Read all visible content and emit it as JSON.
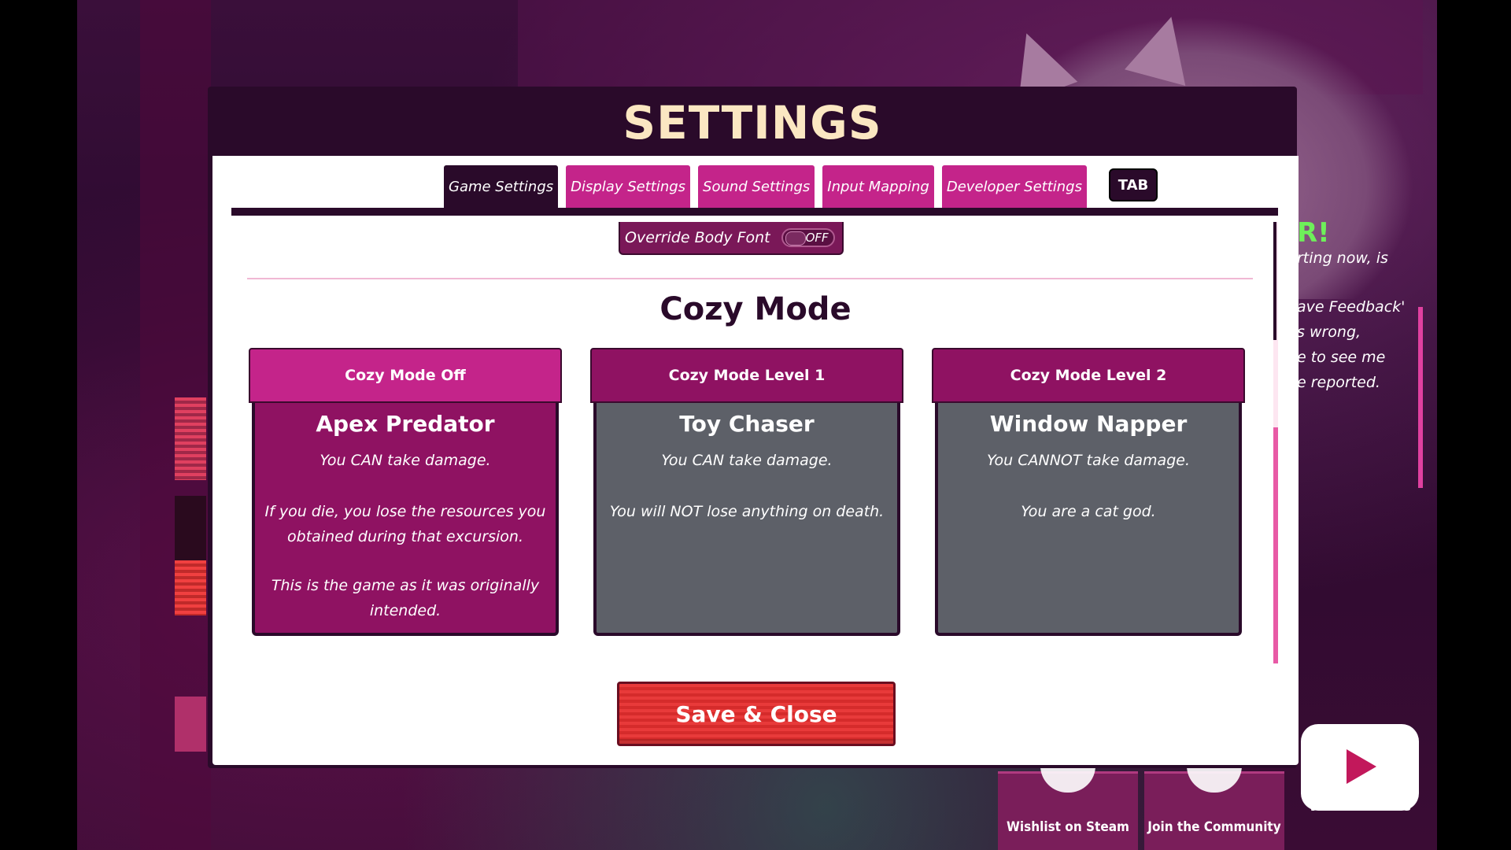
{
  "modal": {
    "title": "SETTINGS"
  },
  "tabs": [
    {
      "label": "Game Settings",
      "active": true
    },
    {
      "label": "Display Settings",
      "active": false
    },
    {
      "label": "Sound Settings",
      "active": false
    },
    {
      "label": "Input Mapping",
      "active": false
    },
    {
      "label": "Developer Settings",
      "active": false
    }
  ],
  "tab_key_hint": "TAB",
  "override_body_font": {
    "label": "Override Body Font",
    "state": "OFF"
  },
  "cozy_mode": {
    "title": "Cozy Mode",
    "options": [
      {
        "header": "Cozy Mode Off",
        "name": "Apex Predator",
        "selected": true,
        "lines": [
          "You CAN take damage.",
          "If you die, you lose the resources you obtained during that excursion.",
          "This is the game as it was originally intended."
        ]
      },
      {
        "header": "Cozy Mode Level 1",
        "name": "Toy Chaser",
        "selected": false,
        "lines": [
          "You CAN take damage.",
          "You will NOT lose anything on death."
        ]
      },
      {
        "header": "Cozy Mode Level 2",
        "name": "Window Napper",
        "selected": false,
        "lines": [
          "You CANNOT take damage.",
          "You are a cat god."
        ]
      }
    ]
  },
  "save_button": "Save & Close",
  "background": {
    "news_header": "R!",
    "news_lines": [
      "rting now, is",
      "ave Feedback'",
      "s wrong,",
      "e to see me",
      "e reported."
    ],
    "social": [
      "Wishlist on Steam",
      "Join the Community",
      "Watch Videos"
    ]
  },
  "colors": {
    "accent": "#c4248a",
    "dark": "#2a0a2a",
    "selected_card": "#8f1262",
    "unselected_card": "#5d6068",
    "save": "#e83a3a"
  }
}
